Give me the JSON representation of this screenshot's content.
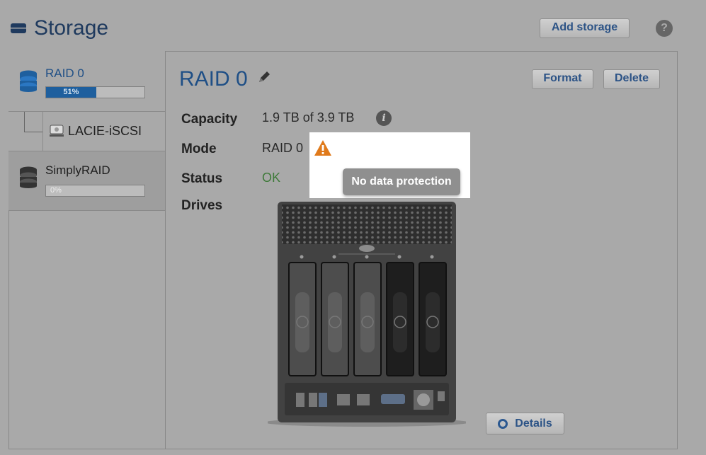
{
  "header": {
    "title": "Storage",
    "add_storage_label": "Add storage",
    "help_label": "?"
  },
  "sidebar": {
    "items": [
      {
        "label": "RAID 0",
        "usage_percent": 51,
        "usage_text": "51%"
      },
      {
        "label": "LACIE-iSCSI"
      },
      {
        "label": "SimplyRAID",
        "usage_percent": 0,
        "usage_text": "0%"
      }
    ]
  },
  "detail": {
    "title": "RAID 0",
    "format_label": "Format",
    "delete_label": "Delete",
    "fields": {
      "capacity_label": "Capacity",
      "capacity_value": "1.9 TB of 3.9 TB",
      "mode_label": "Mode",
      "mode_value": "RAID 0",
      "status_label": "Status",
      "status_value": "OK",
      "drives_label": "Drives"
    },
    "tooltip": "No data protection",
    "details_label": "Details",
    "drive_bays": [
      {
        "state": "populated"
      },
      {
        "state": "populated"
      },
      {
        "state": "populated"
      },
      {
        "state": "empty"
      },
      {
        "state": "empty"
      }
    ]
  },
  "colors": {
    "accent_blue": "#1f4f86",
    "status_ok": "#3f7a3a",
    "warning": "#e07a1b",
    "progress": "#1e5f9e"
  },
  "icons": {
    "header": "storage-drive-icon",
    "edit": "pencil-icon",
    "info": "info-icon",
    "warning": "warning-icon",
    "help": "help-icon",
    "details": "magnifier-icon"
  }
}
